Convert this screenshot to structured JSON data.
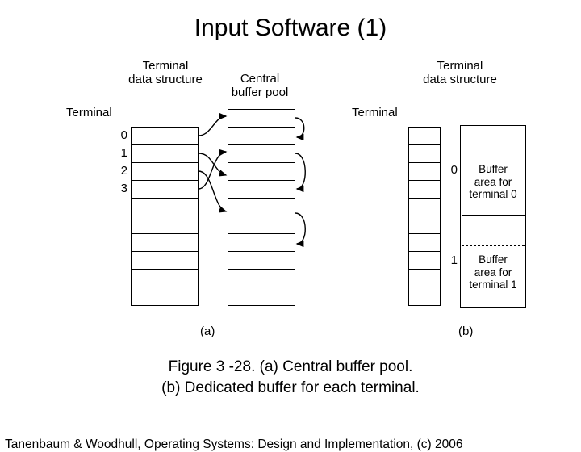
{
  "title": "Input Software (1)",
  "labels": {
    "terminal": "Terminal",
    "term_ds": "Terminal\ndata structure",
    "central_pool": "Central\nbuffer pool"
  },
  "left": {
    "indices": [
      "0",
      "1",
      "2",
      "3"
    ]
  },
  "right": {
    "idx0": "0",
    "idx1": "1",
    "buf0": "Buffer\narea for\nterminal 0",
    "buf1": "Buffer\narea for\nterminal 1"
  },
  "parts": {
    "a": "(a)",
    "b": "(b)"
  },
  "caption_line1": "Figure 3 -28. (a) Central buffer pool.",
  "caption_line2": "(b) Dedicated buffer for each terminal.",
  "footer": "Tanenbaum & Woodhull, Operating Systems: Design and Implementation, (c) 2006"
}
